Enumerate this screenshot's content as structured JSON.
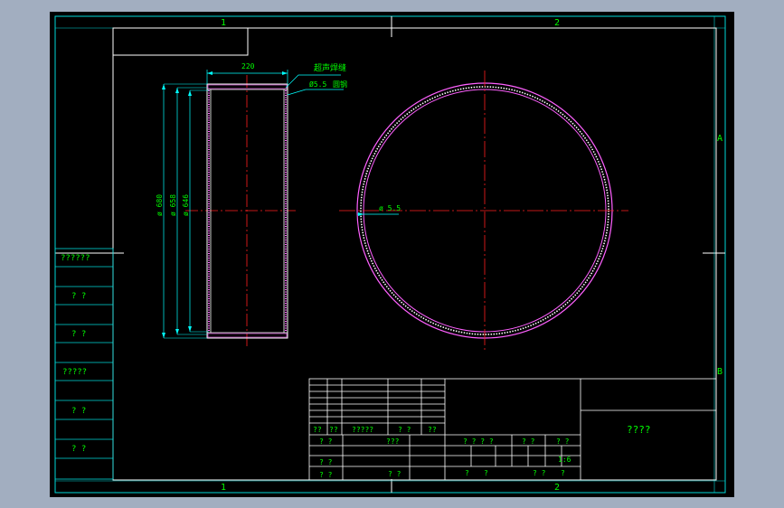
{
  "frame": {
    "zone_columns": [
      "1",
      "2"
    ],
    "zone_rows": [
      "A",
      "B"
    ]
  },
  "side_view": {
    "top_dimension": "220",
    "diameters": [
      "ø 680",
      "ø 658",
      "ø 646"
    ],
    "annotation_weld": "超声焊缝",
    "annotation_thickness": "Ø5.5",
    "annotation_material": "圆钢"
  },
  "front_view": {
    "thickness_label": "ø 5.5"
  },
  "left_strip": {
    "labels": [
      "??????",
      "? ?",
      "? ?",
      "?????",
      "? ?",
      "? ?"
    ]
  },
  "title_block": {
    "revision_headers": [
      "??",
      "??",
      "?????",
      "? ?",
      "??"
    ],
    "sign_rows": [
      "? ?",
      "???",
      "? ?",
      "? ?"
    ],
    "scale_headers": [
      "? ? ? ?",
      "? ?",
      "? ?"
    ],
    "scale_value": "1:6",
    "sheet_labels": [
      "?",
      "?",
      "? ?",
      "?"
    ],
    "drawing_title": "????"
  },
  "colors": {
    "frame": "#00d8d8",
    "text": "#00ff00",
    "outline": "#ffffff",
    "centerline": "#ff2020",
    "ring": "#ff60ff",
    "dimension": "#00ffff"
  }
}
